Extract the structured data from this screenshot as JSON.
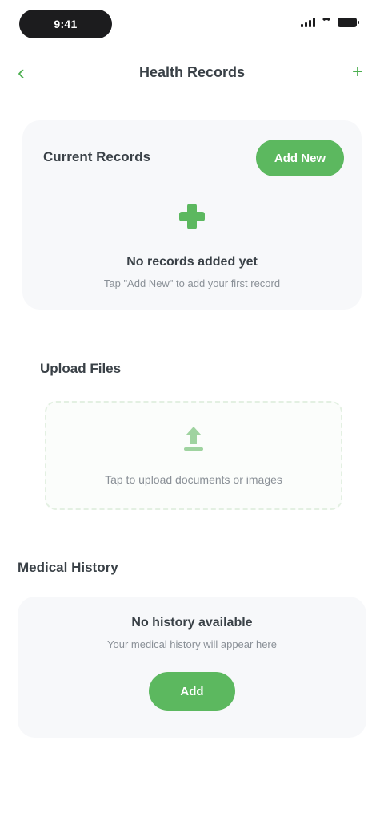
{
  "status_bar": {
    "time": "9:41"
  },
  "nav": {
    "title": "Health Records",
    "back_glyph": "‹",
    "action_glyph": "+"
  },
  "records_card": {
    "title": "Current Records",
    "add_button": "Add New",
    "empty_title": "No records added yet",
    "empty_subtitle": "Tap \"Add New\" to add your first record"
  },
  "upload_section": {
    "title": "Upload Files",
    "upload_text": "Tap to upload documents or images"
  },
  "history_section": {
    "title": "Medical History",
    "empty_title": "No history available",
    "empty_subtitle": "Your medical history will appear here",
    "add_button": "Add"
  },
  "colors": {
    "accent": "#5cb85f",
    "card_bg": "#f7f8fa",
    "text": "#3a4147",
    "muted": "#8a9097"
  },
  "icons": {
    "back": "chevron-left-icon",
    "add": "plus-icon",
    "records_empty": "medical-cross-icon",
    "upload": "upload-icon",
    "battery": "battery-icon",
    "wifi": "wifi-icon",
    "signal": "signal-icon"
  }
}
